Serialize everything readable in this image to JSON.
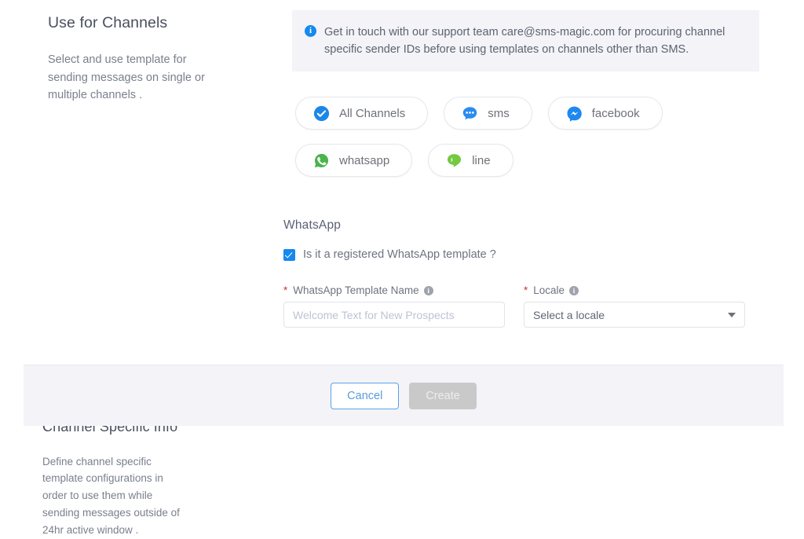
{
  "channels_section": {
    "title": "Use for Channels",
    "description": "Select and use template for sending messages on single or multiple channels .",
    "info_banner": {
      "icon": "info-icon",
      "text": "Get in touch with our support team care@sms-magic.com for procuring channel specific sender IDs before using templates on channels other than SMS.",
      "background": "#f3f3f8",
      "icon_color": "#1589ee"
    },
    "chips": [
      {
        "label": "All Channels",
        "icon": "check-circle-icon",
        "color": "#1b87e8",
        "selected": true
      },
      {
        "label": "sms",
        "icon": "sms-bubble-icon",
        "color": "#2b8cf0",
        "selected": false
      },
      {
        "label": "facebook",
        "icon": "facebook-messenger-icon",
        "color": "#1e88f0",
        "selected": false
      },
      {
        "label": "whatsapp",
        "icon": "whatsapp-icon",
        "color": "#4ab54a",
        "selected": false
      },
      {
        "label": "line",
        "icon": "line-icon",
        "color": "#73c940",
        "selected": false
      }
    ]
  },
  "specific_section": {
    "title": "Channel Specific Info",
    "description": "Define channel specific template configurations in order to use them while sending messages outside of 24hr active window .",
    "channel_heading": "WhatsApp",
    "checkbox": {
      "label": "Is it a registered WhatsApp template ?",
      "checked": true,
      "color": "#1589ee"
    },
    "fields": [
      {
        "label": "WhatsApp Template Name",
        "required_marker": "*",
        "help_icon": "info-icon",
        "placeholder": "Welcome Text for New Prospects",
        "value": ""
      },
      {
        "label": "Locale",
        "required_marker": "*",
        "help_icon": "info-icon",
        "selected_value": "Select a locale",
        "caret": "chevron-down-icon"
      }
    ]
  },
  "footer": {
    "cancel_label": "Cancel",
    "create_label": "Create",
    "cancel_accent": "#5aa2e8",
    "create_disabled_bg": "#c9c9c9"
  }
}
